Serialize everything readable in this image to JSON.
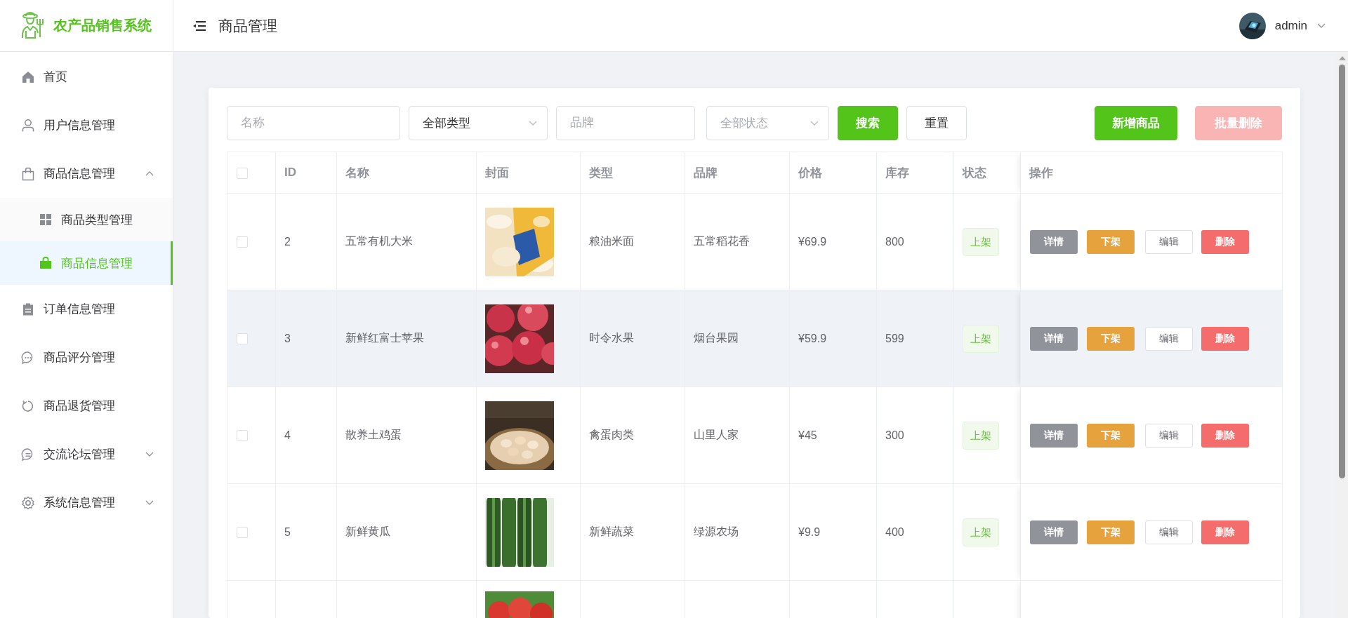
{
  "app": {
    "title": "农产品销售系统"
  },
  "header": {
    "page_title": "商品管理",
    "user": "admin"
  },
  "sidebar": {
    "items": [
      {
        "label": "首页",
        "selected": false
      },
      {
        "label": "用户信息管理",
        "selected": false
      },
      {
        "label": "商品信息管理",
        "selected": false,
        "expanded": true,
        "children": [
          {
            "label": "商品类型管理",
            "selected": false
          },
          {
            "label": "商品信息管理",
            "selected": true
          }
        ]
      },
      {
        "label": "订单信息管理",
        "selected": false
      },
      {
        "label": "商品评分管理",
        "selected": false
      },
      {
        "label": "商品退货管理",
        "selected": false
      },
      {
        "label": "交流论坛管理",
        "selected": false,
        "expanded": false
      },
      {
        "label": "系统信息管理",
        "selected": false,
        "expanded": false
      }
    ]
  },
  "toolbar": {
    "filters": [
      {
        "kind": "input",
        "placeholder": "名称"
      },
      {
        "kind": "select",
        "value": "全部类型"
      },
      {
        "kind": "input",
        "placeholder": "品牌"
      },
      {
        "kind": "select",
        "placeholder": "全部状态"
      }
    ],
    "buttons": [
      {
        "label": "搜索",
        "kind": "primary",
        "disabled": false
      },
      {
        "label": "重置",
        "kind": "plain",
        "disabled": false
      }
    ],
    "actions": [
      {
        "label": "新增商品",
        "kind": "primary",
        "disabled": false
      },
      {
        "label": "批量删除",
        "kind": "danger",
        "disabled": true
      }
    ]
  },
  "table": {
    "select_all": {
      "checked": false
    },
    "columns": [
      "ID",
      "名称",
      "封面",
      "类型",
      "品牌",
      "价格",
      "库存",
      "状态",
      "操作"
    ],
    "rows": [
      {
        "checked": false,
        "highlighted": false,
        "id": "2",
        "name": "五常有机大米",
        "cover": {
          "kind": "picture"
        },
        "type": "粮油米面",
        "brand": "五常稻花香",
        "price": "¥69.9",
        "stock": "800",
        "status": "上架",
        "actions": [
          {
            "label": "详情",
            "kind": "info"
          },
          {
            "label": "下架",
            "kind": "warning"
          },
          {
            "label": "编辑",
            "kind": "plain"
          },
          {
            "label": "删除",
            "kind": "danger"
          }
        ]
      },
      {
        "checked": false,
        "highlighted": true,
        "id": "3",
        "name": "新鲜红富士苹果",
        "cover": {
          "kind": "picture"
        },
        "type": "时令水果",
        "brand": "烟台果园",
        "price": "¥59.9",
        "stock": "599",
        "status": "上架",
        "actions": [
          {
            "label": "详情",
            "kind": "info"
          },
          {
            "label": "下架",
            "kind": "warning"
          },
          {
            "label": "编辑",
            "kind": "plain"
          },
          {
            "label": "删除",
            "kind": "danger"
          }
        ]
      },
      {
        "checked": false,
        "highlighted": false,
        "id": "4",
        "name": "散养土鸡蛋",
        "cover": {
          "kind": "picture"
        },
        "type": "禽蛋肉类",
        "brand": "山里人家",
        "price": "¥45",
        "stock": "300",
        "status": "上架",
        "actions": [
          {
            "label": "详情",
            "kind": "info"
          },
          {
            "label": "下架",
            "kind": "warning"
          },
          {
            "label": "编辑",
            "kind": "plain"
          },
          {
            "label": "删除",
            "kind": "danger"
          }
        ]
      },
      {
        "checked": false,
        "highlighted": false,
        "id": "5",
        "name": "新鲜黄瓜",
        "cover": {
          "kind": "picture"
        },
        "type": "新鲜蔬菜",
        "brand": "绿源农场",
        "price": "¥9.9",
        "stock": "400",
        "status": "上架",
        "actions": [
          {
            "label": "详情",
            "kind": "info"
          },
          {
            "label": "下架",
            "kind": "warning"
          },
          {
            "label": "编辑",
            "kind": "plain"
          },
          {
            "label": "删除",
            "kind": "danger"
          }
        ]
      },
      {
        "cover": {
          "kind": "picture"
        }
      }
    ]
  }
}
